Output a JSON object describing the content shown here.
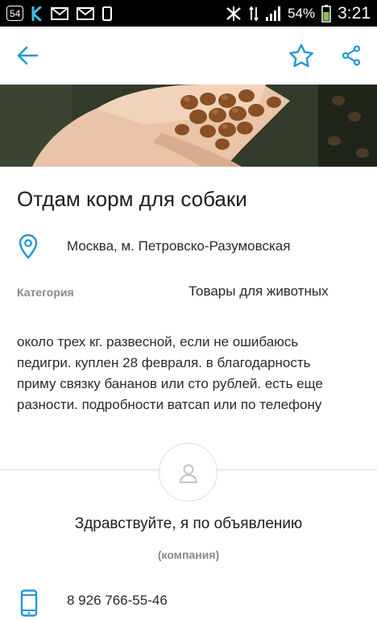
{
  "status_bar": {
    "notif_count": "54",
    "battery_percent": "54%",
    "time": "3:21",
    "icons": [
      "kaspersky-k-icon",
      "mail-icon",
      "mail-icon",
      "phone-icon",
      "vibrate-icon",
      "network-4g-icon",
      "signal-icon",
      "battery-icon"
    ]
  },
  "toolbar": {
    "back_icon": "arrow-left-icon",
    "favorite_icon": "star-outline-icon",
    "share_icon": "share-icon",
    "accent_color": "#2196d9"
  },
  "listing": {
    "title": "Отдам корм для собаки",
    "location": "Москва, м. Петровско-Разумовская",
    "category_label": "Категория",
    "category_value": "Товары для животных",
    "description_lines": [
      "около трех кг. развесной, если не ошибаюсь",
      "педигри. куплен 28 февраля. в благодарность",
      "приму связку бананов или сто рублей. есть еще",
      "разности. подробности ватсап или по телефону"
    ]
  },
  "seller": {
    "avatar_icon": "user-avatar-icon",
    "greeting": "Здравствуйте, я по объявлению",
    "type": "(компания)",
    "phone": "8 926 766-55-46",
    "phone_icon": "mobile-phone-icon"
  }
}
